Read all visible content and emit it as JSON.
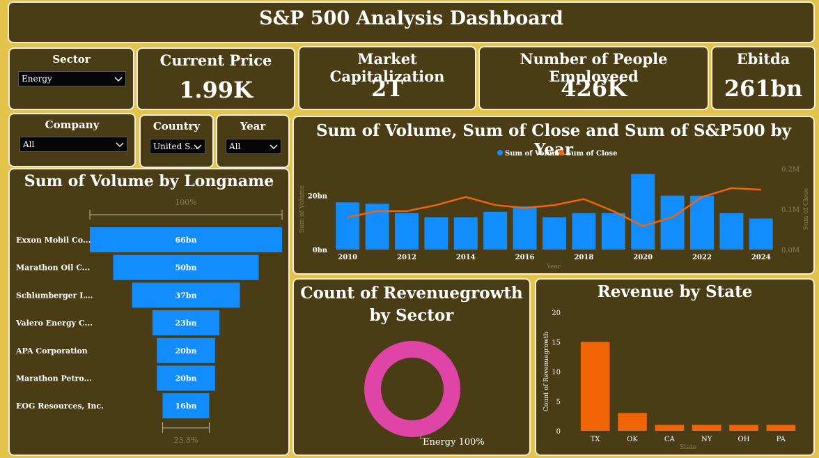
{
  "header": {
    "title": "S&P 500 Analysis Dashboard"
  },
  "kpis": [
    {
      "label": "Current Price",
      "value": "1.99K"
    },
    {
      "label": "Market Capitalization",
      "value": "2T"
    },
    {
      "label": "Number of People Employeed",
      "value": "426K"
    },
    {
      "label": "Ebitda",
      "value": "261bn"
    }
  ],
  "slicers": {
    "sector": {
      "label": "Sector",
      "value": "Energy"
    },
    "company": {
      "label": "Company",
      "value": "All"
    },
    "country": {
      "label": "Country",
      "value": "United S..."
    },
    "year": {
      "label": "Year",
      "value": "All"
    }
  },
  "colors": {
    "blue": "#118dff",
    "orange": "#f26507",
    "pink": "#e044a7",
    "panel": "#4a3d16"
  },
  "chart_data": [
    {
      "type": "bar",
      "subtype": "funnel",
      "title": "Sum of Volume by Longname",
      "categories": [
        "Exxon Mobil Co...",
        "Marathon Oil C...",
        "Schlumberger L...",
        "Valero Energy C...",
        "APA Corporation",
        "Marathon Petro...",
        "EOG Resources, Inc."
      ],
      "values": [
        66,
        50,
        37,
        23,
        20,
        20,
        16
      ],
      "value_labels": [
        "66bn",
        "50bn",
        "37bn",
        "23bn",
        "20bn",
        "20bn",
        "16bn"
      ],
      "top_pct": "100%",
      "bottom_pct": "23.8%"
    },
    {
      "type": "bar",
      "subtype": "combo-bar-line",
      "title": "Sum of Volume, Sum of Close and Sum of S&P500 by Year",
      "x": [
        2010,
        2011,
        2012,
        2013,
        2014,
        2015,
        2016,
        2017,
        2018,
        2019,
        2020,
        2021,
        2022,
        2023,
        2024
      ],
      "xticks": [
        2010,
        2012,
        2014,
        2016,
        2018,
        2020,
        2022,
        2024
      ],
      "series": [
        {
          "name": "Sum of Volume",
          "axis": "left",
          "chart": "bar",
          "values": [
            17.5,
            17,
            13.5,
            12,
            12,
            14,
            16,
            12,
            13.5,
            13.5,
            28,
            20,
            20,
            13.5,
            11.5
          ]
        },
        {
          "name": "Sum of Close",
          "axis": "right",
          "chart": "line",
          "values": [
            0.08,
            0.095,
            0.095,
            0.11,
            0.13,
            0.11,
            0.103,
            0.11,
            0.125,
            0.095,
            0.058,
            0.08,
            0.13,
            0.152,
            0.148
          ]
        }
      ],
      "xlabel": "Year",
      "ylabel": "Sum of Volume",
      "y2label": "Sum of Close",
      "ylim": [
        0,
        30
      ],
      "y2lim": [
        0,
        0.2
      ],
      "yticks": [
        {
          "v": 0,
          "label": "0bn"
        },
        {
          "v": 20,
          "label": "20bn"
        }
      ],
      "y2ticks": [
        {
          "v": 0,
          "label": "0.0M"
        },
        {
          "v": 0.1,
          "label": "0.1M"
        },
        {
          "v": 0.2,
          "label": "0.2M"
        }
      ],
      "legend": "top-center"
    },
    {
      "type": "pie",
      "subtype": "donut",
      "title": "Count of Revenuegrowth by Sector",
      "slices": [
        {
          "label": "Energy",
          "value": 100
        }
      ],
      "slice_label": "Energy 100%"
    },
    {
      "type": "bar",
      "title": "Revenue by State",
      "categories": [
        "TX",
        "OK",
        "CA",
        "NY",
        "OH",
        "PA"
      ],
      "values": [
        15,
        3,
        1,
        1,
        1,
        1
      ],
      "xlabel": "State",
      "ylabel": "Count of Revenuegrowth",
      "ylim": [
        0,
        20
      ],
      "yticks": [
        0,
        5,
        10,
        15,
        20
      ]
    }
  ]
}
